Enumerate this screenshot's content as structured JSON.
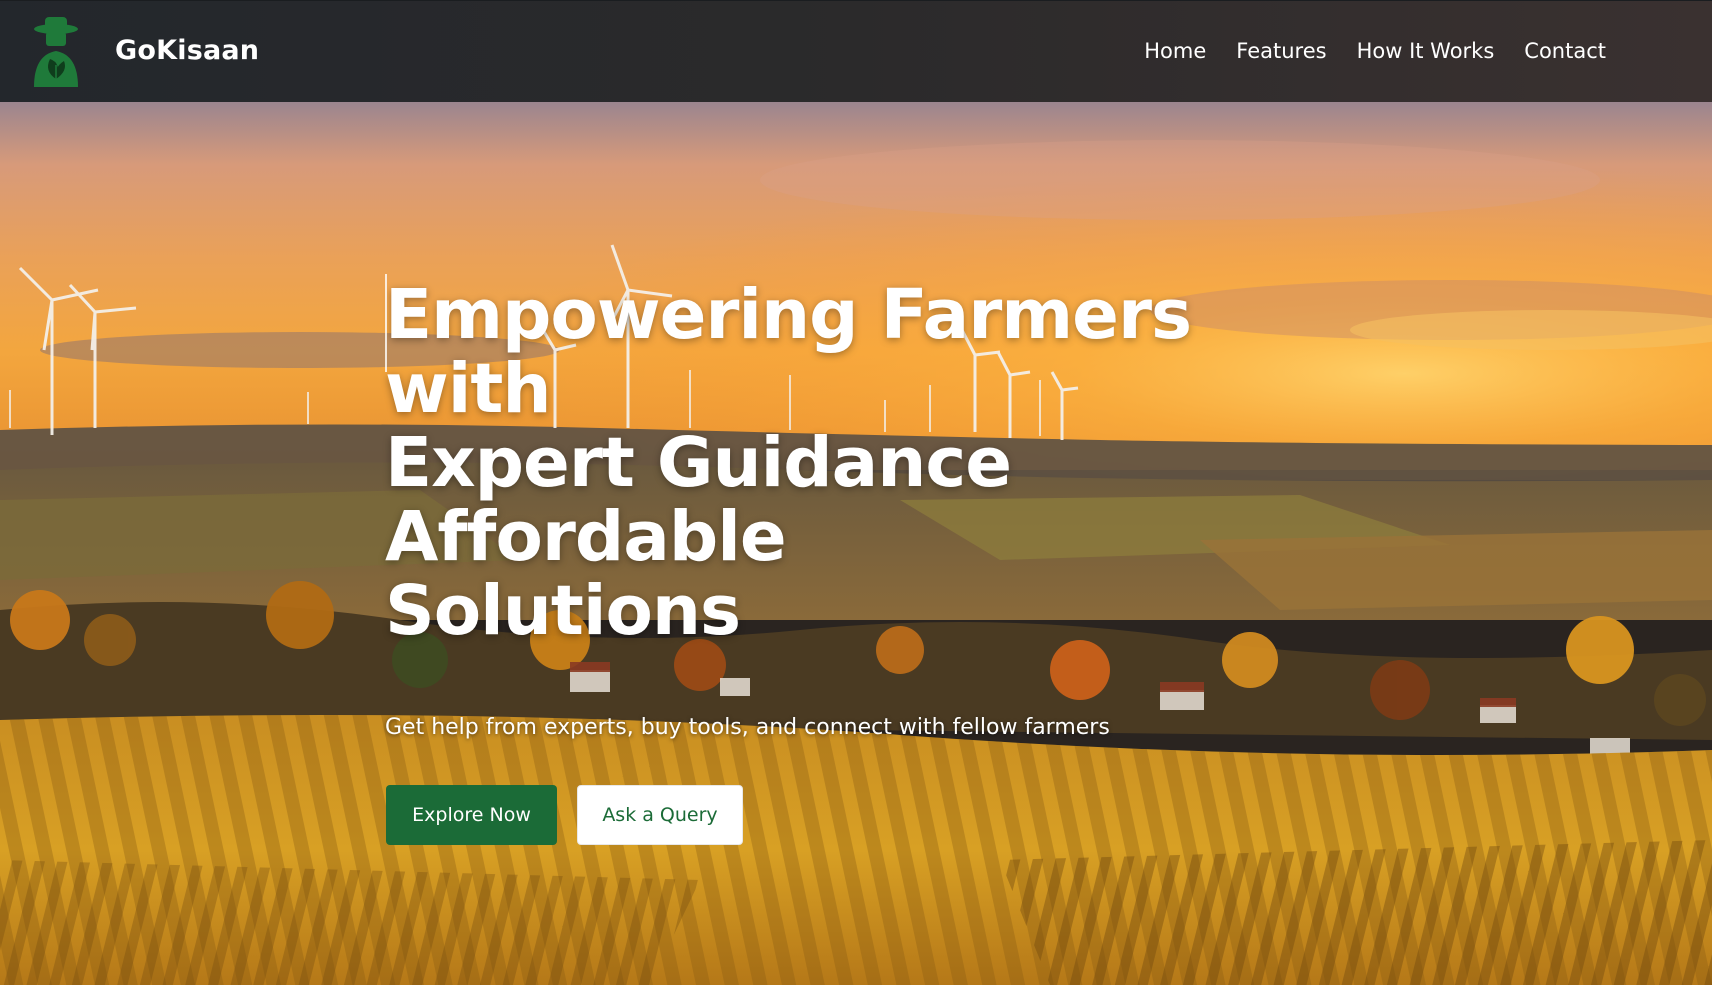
{
  "navbar": {
    "brand_name": "GoKisaan",
    "logo_icon": "farmer-logo-icon",
    "links": [
      {
        "label": "Home"
      },
      {
        "label": "Features"
      },
      {
        "label": "How It Works"
      },
      {
        "label": "Contact"
      }
    ]
  },
  "hero": {
    "title_lines": [
      "Empowering Farmers",
      "with",
      "Expert Guidance",
      "Affordable",
      "Solutions"
    ],
    "subtitle": "Get help from experts, buy tools, and connect with fellow farmers",
    "buttons": {
      "primary_label": "Explore Now",
      "secondary_label": "Ask a Query"
    },
    "background_image": "sunset-farmland-with-wind-turbines"
  },
  "colors": {
    "brand_green": "#1b6b37",
    "navbar_dark": "#262a2e",
    "text_white": "#ffffff"
  }
}
